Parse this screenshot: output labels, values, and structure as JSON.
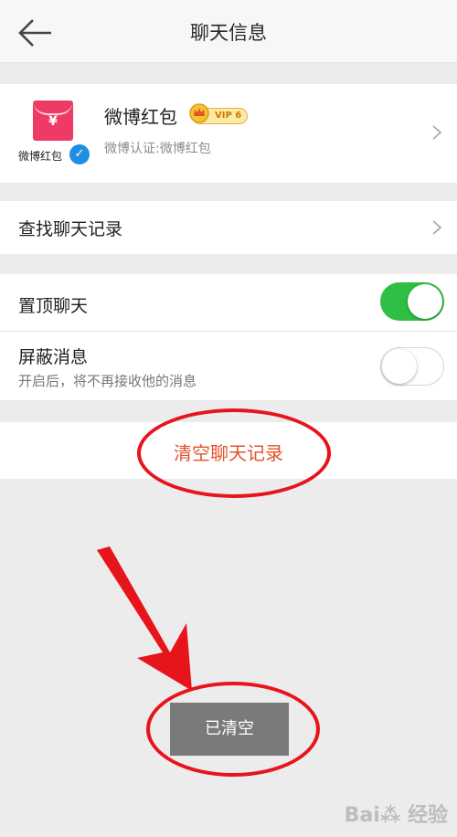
{
  "header": {
    "title": "聊天信息",
    "back_icon": "arrow-left-icon"
  },
  "profile": {
    "name": "微博红包",
    "vip_label": "VIP 6",
    "subtitle": "微博认证:微博红包",
    "avatar_caption": "微博红包",
    "avatar_glyph": "¥",
    "verified_glyph": "✓"
  },
  "rows": {
    "search_history": "查找聊天记录",
    "pin_chat": "置顶聊天",
    "pin_chat_on": true,
    "mute": "屏蔽消息",
    "mute_desc": "开启后，将不再接收他的消息",
    "mute_on": false
  },
  "actions": {
    "clear_history": "清空聊天记录"
  },
  "toast": {
    "text": "已清空"
  },
  "watermark": {
    "text": "Bai⁂ 经验"
  },
  "colors": {
    "toggle_on": "#2fbf44",
    "clear_text": "#e2522a",
    "annotation_red": "#e8141b",
    "avatar_red": "#ee3a64"
  }
}
